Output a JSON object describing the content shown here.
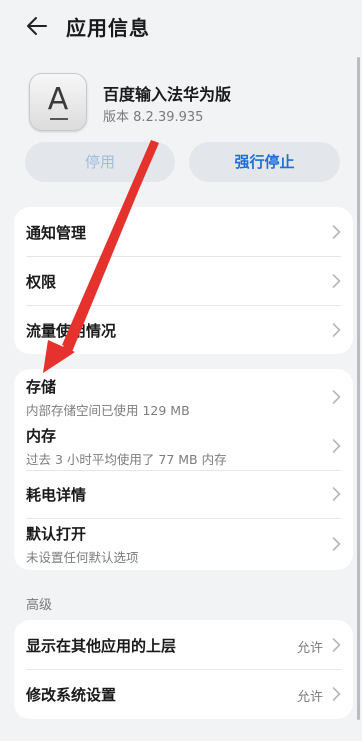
{
  "header": {
    "title": "应用信息",
    "back_icon": "arrow-left-icon"
  },
  "app": {
    "name": "百度输入法华为版",
    "version": "版本 8.2.39.935",
    "icon_letter": "A"
  },
  "actions": {
    "disable_label": "停用",
    "force_stop_label": "强行停止"
  },
  "group1": {
    "items": [
      {
        "label": "通知管理"
      },
      {
        "label": "权限"
      },
      {
        "label": "流量使用情况"
      }
    ]
  },
  "group2": {
    "items": [
      {
        "label": "存储",
        "sub": "内部存储空间已使用 129 MB"
      },
      {
        "label": "内存",
        "sub": "过去 3 小时平均使用了 77 MB 内存"
      },
      {
        "label": "耗电详情"
      },
      {
        "label": "默认打开",
        "sub": "未设置任何默认选项"
      }
    ]
  },
  "advanced": {
    "header": "高级",
    "items": [
      {
        "label": "显示在其他应用的上层",
        "value": "允许"
      },
      {
        "label": "修改系统设置",
        "value": "允许"
      }
    ]
  },
  "colors": {
    "background": "#f1f3f5",
    "card": "#ffffff",
    "accent_blue": "#1e6fd9",
    "disabled_blue": "#9cbde0",
    "annotation_red": "#e5322d"
  },
  "annotation": {
    "arrow_icon": "red-arrow-annotation"
  }
}
